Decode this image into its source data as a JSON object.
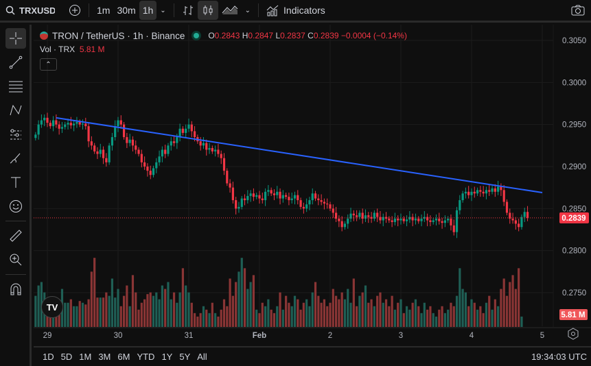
{
  "toolbar": {
    "symbol": "TRXUSDT",
    "intervals": [
      "1m",
      "30m",
      "1h"
    ],
    "active_interval": "1h",
    "indicators_label": "Indicators"
  },
  "legend": {
    "title": "TRON / TetherUS · 1h · Binance",
    "o_label": "O",
    "o": "0.2843",
    "h_label": "H",
    "h": "0.2847",
    "l_label": "L",
    "l": "0.2837",
    "c_label": "C",
    "c": "0.2839",
    "change": "−0.0004 (−0.14%)",
    "vol_label": "Vol · TRX",
    "vol": "5.81 M"
  },
  "colors": {
    "up": "#089981",
    "down": "#f23645",
    "vol_up": "#1f5f55",
    "vol_down": "#8a3535",
    "trendline": "#2962ff",
    "bg": "#0f0f0f"
  },
  "price_axis": {
    "ticks": [
      "0.3050",
      "0.3000",
      "0.2950",
      "0.2900",
      "0.2850",
      "0.2800",
      "0.2750"
    ],
    "last_price": "0.2839",
    "last_volume": "5.81 M"
  },
  "time_axis": {
    "ticks": [
      "29",
      "30",
      "31",
      "Feb",
      "2",
      "3",
      "4",
      "5"
    ]
  },
  "ranges": [
    "1D",
    "5D",
    "1M",
    "3M",
    "6M",
    "YTD",
    "1Y",
    "5Y",
    "All"
  ],
  "clock": "19:34:03 UTC",
  "chart_data": {
    "type": "candlestick",
    "interval": "1h",
    "start": "Jan 28 20:00",
    "ylim": [
      0.2725,
      0.3065
    ],
    "closes": [
      0.2938,
      0.295,
      0.2955,
      0.2958,
      0.2952,
      0.2948,
      0.2955,
      0.295,
      0.2945,
      0.2947,
      0.295,
      0.2952,
      0.2949,
      0.2951,
      0.2953,
      0.295,
      0.2951,
      0.2948,
      0.293,
      0.2925,
      0.2918,
      0.2915,
      0.292,
      0.291,
      0.2905,
      0.2925,
      0.2935,
      0.2948,
      0.2955,
      0.295,
      0.2935,
      0.2928,
      0.2932,
      0.2925,
      0.292,
      0.2915,
      0.2905,
      0.29,
      0.2895,
      0.289,
      0.2898,
      0.2905,
      0.2912,
      0.292,
      0.2915,
      0.2925,
      0.293,
      0.2928,
      0.2935,
      0.2945,
      0.294,
      0.2945,
      0.295,
      0.2942,
      0.2935,
      0.293,
      0.2925,
      0.2928,
      0.292,
      0.2922,
      0.2918,
      0.292,
      0.2915,
      0.291,
      0.2895,
      0.288,
      0.2875,
      0.286,
      0.285,
      0.2852,
      0.2862,
      0.286,
      0.2865,
      0.2868,
      0.2864,
      0.2866,
      0.2862,
      0.286,
      0.287,
      0.2872,
      0.2868,
      0.2866,
      0.287,
      0.2862,
      0.2866,
      0.2864,
      0.286,
      0.2862,
      0.2866,
      0.286,
      0.2852,
      0.285,
      0.2855,
      0.286,
      0.2868,
      0.2862,
      0.286,
      0.2858,
      0.2856,
      0.2855,
      0.285,
      0.2845,
      0.2838,
      0.2835,
      0.2828,
      0.2832,
      0.2838,
      0.2844,
      0.2842,
      0.284,
      0.2845,
      0.2838,
      0.2842,
      0.284,
      0.2838,
      0.2845,
      0.284,
      0.2836,
      0.284,
      0.2838,
      0.2836,
      0.2834,
      0.2838,
      0.2836,
      0.2838,
      0.2835,
      0.2837,
      0.284,
      0.2836,
      0.2838,
      0.2835,
      0.2838,
      0.284,
      0.2836,
      0.2834,
      0.2836,
      0.2838,
      0.2835,
      0.2833,
      0.2836,
      0.2838,
      0.283,
      0.2822,
      0.2848,
      0.286,
      0.2868,
      0.287,
      0.2866,
      0.287,
      0.2868,
      0.2872,
      0.287,
      0.2868,
      0.2872,
      0.287,
      0.2874,
      0.287,
      0.2876,
      0.2872,
      0.2858,
      0.2845,
      0.2838,
      0.2836,
      0.2832,
      0.2828,
      0.284,
      0.2846,
      0.2839
    ],
    "volumes_m": [
      18,
      24,
      26,
      20,
      14,
      10,
      6,
      7,
      12,
      22,
      14,
      14,
      16,
      12,
      12,
      15,
      14,
      13,
      16,
      32,
      40,
      17,
      17,
      17,
      20,
      18,
      28,
      17,
      22,
      12,
      18,
      24,
      12,
      30,
      20,
      10,
      14,
      16,
      19,
      20,
      18,
      20,
      16,
      24,
      22,
      26,
      16,
      20,
      14,
      20,
      34,
      24,
      20,
      14,
      8,
      6,
      8,
      12,
      10,
      8,
      14,
      8,
      6,
      10,
      16,
      12,
      28,
      18,
      26,
      32,
      40,
      34,
      22,
      26,
      30,
      10,
      8,
      14,
      12,
      16,
      10,
      8,
      12,
      20,
      10,
      18,
      14,
      12,
      18,
      16,
      10,
      14,
      16,
      12,
      20,
      26,
      18,
      14,
      16,
      12,
      14,
      22,
      18,
      16,
      20,
      16,
      22,
      14,
      28,
      12,
      18,
      20,
      24,
      14,
      16,
      12,
      18,
      20,
      14,
      16,
      12,
      18,
      10,
      14,
      16,
      8,
      12,
      10,
      14,
      16,
      12,
      8,
      14,
      10,
      12,
      8,
      6,
      10,
      12,
      8,
      10,
      14,
      12,
      18,
      34,
      22,
      20,
      12,
      16,
      14,
      10,
      12,
      8,
      14,
      18,
      10,
      16,
      12,
      22,
      28,
      18,
      26,
      30,
      22,
      34,
      6
    ],
    "trendline": {
      "from": {
        "time": "Jan 28 23:00",
        "price": 0.2958
      },
      "to": {
        "time": "Feb 5 00:00",
        "price": 0.2869
      }
    }
  }
}
